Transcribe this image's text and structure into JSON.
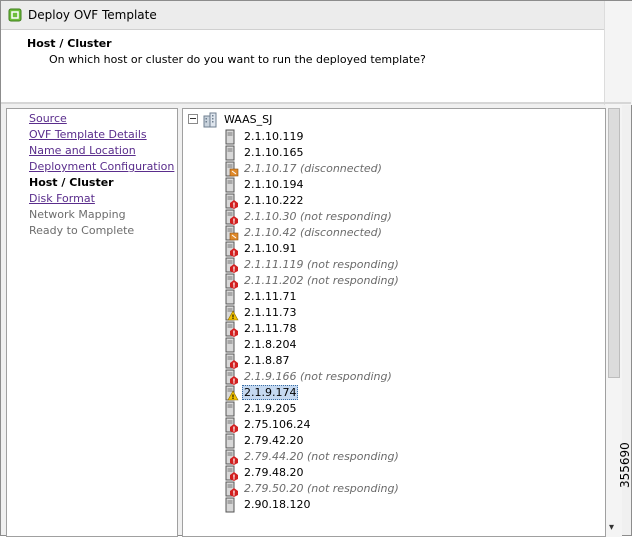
{
  "window": {
    "title": "Deploy OVF Template",
    "icon": "ovf-deploy-icon"
  },
  "header": {
    "title": "Host / Cluster",
    "subtitle": "On which host or cluster do you want to run the deployed template?"
  },
  "steps": [
    {
      "label": "Source",
      "state": "link"
    },
    {
      "label": "OVF Template Details",
      "state": "link"
    },
    {
      "label": "Name and Location",
      "state": "link"
    },
    {
      "label": "Deployment Configuration",
      "state": "link"
    },
    {
      "label": "Host / Cluster",
      "state": "current"
    },
    {
      "label": "Disk Format",
      "state": "link"
    },
    {
      "label": "Network Mapping",
      "state": "disabled"
    },
    {
      "label": "Ready to Complete",
      "state": "disabled"
    }
  ],
  "tree": {
    "root_label": "WAAS_SJ",
    "root_icon": "datacenter-icon",
    "expander_icon": "collapse-minus-icon",
    "hosts": [
      {
        "label": "2.1.10.119",
        "status": "ok"
      },
      {
        "label": "2.1.10.165",
        "status": "ok"
      },
      {
        "label": "2.1.10.17 (disconnected)",
        "status": "disconnected"
      },
      {
        "label": "2.1.10.194",
        "status": "ok"
      },
      {
        "label": "2.1.10.222",
        "status": "error"
      },
      {
        "label": "2.1.10.30 (not responding)",
        "status": "not-responding"
      },
      {
        "label": "2.1.10.42 (disconnected)",
        "status": "disconnected"
      },
      {
        "label": "2.1.10.91",
        "status": "error"
      },
      {
        "label": "2.1.11.119 (not responding)",
        "status": "not-responding"
      },
      {
        "label": "2.1.11.202 (not responding)",
        "status": "not-responding"
      },
      {
        "label": "2.1.11.71",
        "status": "ok"
      },
      {
        "label": "2.1.11.73",
        "status": "warning"
      },
      {
        "label": "2.1.11.78",
        "status": "error"
      },
      {
        "label": "2.1.8.204",
        "status": "ok"
      },
      {
        "label": "2.1.8.87",
        "status": "error"
      },
      {
        "label": "2.1.9.166 (not responding)",
        "status": "not-responding"
      },
      {
        "label": "2.1.9.174",
        "status": "warning",
        "selected": true
      },
      {
        "label": "2.1.9.205",
        "status": "ok"
      },
      {
        "label": "2.75.106.24",
        "status": "error"
      },
      {
        "label": "2.79.42.20",
        "status": "ok"
      },
      {
        "label": "2.79.44.20 (not responding)",
        "status": "not-responding"
      },
      {
        "label": "2.79.48.20",
        "status": "error"
      },
      {
        "label": "2.79.50.20 (not responding)",
        "status": "not-responding"
      },
      {
        "label": "2.90.18.120",
        "status": "ok"
      }
    ]
  },
  "figure_id": "355690",
  "colors": {
    "link": "#5a2d8c",
    "disabled_text": "#6d6d6d",
    "selection": "#c5d9f1",
    "error": "#d21f1f",
    "warning": "#f2c200",
    "disconnected": "#e08a2a"
  }
}
